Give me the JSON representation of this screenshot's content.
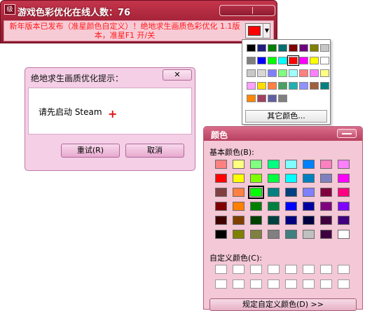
{
  "main_window": {
    "logo": "级",
    "title": "游戏色彩优化在线人数：76",
    "announcement": "新年版本已发布（准星颜色自定义）！绝地求生画质色彩优化 1.1版本，准星F1 开/关",
    "current_color": "#ff0000"
  },
  "color_picker": {
    "colors": [
      "#000000",
      "#1f1f7f",
      "#007f00",
      "#006e6e",
      "#7f0000",
      "#6e007f",
      "#7f7f00",
      "#c6c6c6",
      "#7f7f7f",
      "#0000ff",
      "#00ff00",
      "#00ffff",
      "#ff0000",
      "#ff00ff",
      "#ffff00",
      "#ffffff",
      "#c8c8c8",
      "#d7d7d7",
      "#8080ff",
      "#80ff80",
      "#9fffff",
      "#ff8080",
      "#ff80ff",
      "#ffff80",
      "#ff9fff",
      "#ffdc00",
      "#ff8040",
      "#48a060",
      "#20b0b0",
      "#9090ff",
      "#a06040",
      "#008080",
      "#ff8800",
      "#a04060",
      "#6060a0",
      "#808080"
    ],
    "other_label": "其它颜色..."
  },
  "alert": {
    "title": "绝地求生画质优化提示：",
    "close_glyph": "✕",
    "message": "请先启动 Steam",
    "retry_label": "重试(R)",
    "cancel_label": "取消"
  },
  "color_dialog": {
    "title": "颜色",
    "basic_label": "基本颜色(B):",
    "custom_label": "自定义颜色(C):",
    "define_label": "规定自定义颜色(D) >>",
    "basic_colors": [
      "#ff8080",
      "#ffff80",
      "#80ff80",
      "#00ff80",
      "#80ffff",
      "#0080ff",
      "#ff80c0",
      "#ff80ff",
      "#ff0000",
      "#ffff00",
      "#80ff00",
      "#00ff40",
      "#00ffff",
      "#0080c0",
      "#8080c0",
      "#ff00ff",
      "#804040",
      "#ff8040",
      "#00ff00",
      "#008080",
      "#004080",
      "#8080ff",
      "#800040",
      "#ff0080",
      "#800000",
      "#ff8000",
      "#008000",
      "#008040",
      "#0000ff",
      "#0000a0",
      "#800080",
      "#8000ff",
      "#400000",
      "#804000",
      "#004000",
      "#004040",
      "#000080",
      "#000040",
      "#400040",
      "#400080",
      "#000000",
      "#808000",
      "#808040",
      "#808080",
      "#408080",
      "#c0c0c0",
      "#400040",
      "#ffffff"
    ],
    "selected_index": 18,
    "custom_count": 16
  }
}
